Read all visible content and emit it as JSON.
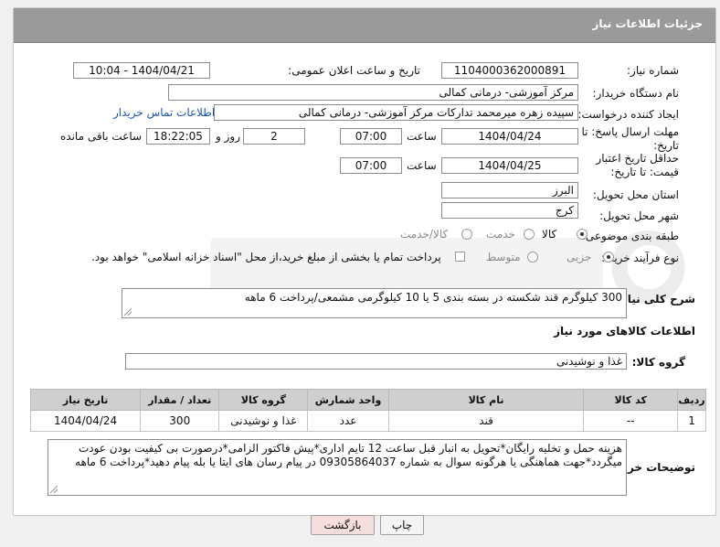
{
  "header": {
    "title": "جزئیات اطلاعات نیاز"
  },
  "form": {
    "need_number": {
      "label": "شماره نیاز:",
      "value": "1104000362000891"
    },
    "announce_datetime": {
      "label": "تاریخ و ساعت اعلان عمومی:",
      "value": "1404/04/21 - 10:04"
    },
    "buyer_org": {
      "label": "نام دستگاه خریدار:",
      "value": "مرکز آموزشی- درمانی کمالی"
    },
    "requester": {
      "label": "ایجاد کننده درخواست:",
      "value": "سپیده زهره میرمحمد تدارکات مرکز آموزشی- درمانی کمالی",
      "contact_link": "اطلاعات تماس خریدار"
    },
    "reply_deadline": {
      "label": "مهلت ارسال پاسخ: تا تاریخ:",
      "date": "1404/04/24",
      "time_label": "ساعت",
      "time": "07:00",
      "days": "2",
      "days_label": "روز و",
      "remaining": "18:22:05",
      "remaining_label": "ساعت باقی مانده"
    },
    "price_validity": {
      "label": "حداقل تاریخ اعتبار قیمت: تا تاریخ:",
      "date": "1404/04/25",
      "time_label": "ساعت",
      "time": "07:00"
    },
    "province": {
      "label": "استان محل تحویل:",
      "value": "البرز"
    },
    "city": {
      "label": "شهر محل تحویل:",
      "value": "کرج"
    },
    "category": {
      "label": "طبقه بندی موضوعی:",
      "options": [
        "کالا",
        "خدمت",
        "کالا/خدمت"
      ],
      "selected": 0
    },
    "process": {
      "label": "نوع فرآیند خرید :",
      "options": [
        "جزیی",
        "متوسط"
      ],
      "selected": 0,
      "payment_note": "پرداخت تمام یا بخشی از مبلغ خرید،از محل \"اسناد خزانه اسلامی\" خواهد بود."
    }
  },
  "description": {
    "label": "شرح کلی نیاز:",
    "value": "300 کیلوگرم قند شکسته در بسته بندی 5 یا 10 کیلوگرمی مشمعی/پرداخت 6 ماهه"
  },
  "goods_section": {
    "title": "اطلاعات کالاهای مورد نیاز",
    "group_label": "گروه کالا:",
    "group_value": "غذا و نوشیدنی"
  },
  "table": {
    "headers": [
      "ردیف",
      "کد کالا",
      "نام کالا",
      "واحد شمارش",
      "گروه کالا",
      "تعداد / مقدار",
      "تاریخ نیاز"
    ],
    "rows": [
      [
        "1",
        "--",
        "قند",
        "عدد",
        "غذا و نوشیدنی",
        "300",
        "1404/04/24"
      ]
    ]
  },
  "buyer_notes": {
    "label": "توضیحات خریدار:",
    "value": "هزینه حمل و تخلیه رایگان*تحویل به انبار قبل ساعت 12 تایم اداری*پیش فاکتور الزامی*درصورت بی کیفیت بودن عودت میگردد*جهت هماهنگی یا هرگونه سوال به شماره 09305864037 در پیام رسان های ایتا یا بله پیام دهید*پرداخت 6 ماهه"
  },
  "buttons": {
    "print": "چاپ",
    "back": "بازگشت"
  },
  "colors": {
    "header_bg": "#9a9a9a",
    "back_button_bg": "#f6dede",
    "link": "#1a56b0"
  }
}
